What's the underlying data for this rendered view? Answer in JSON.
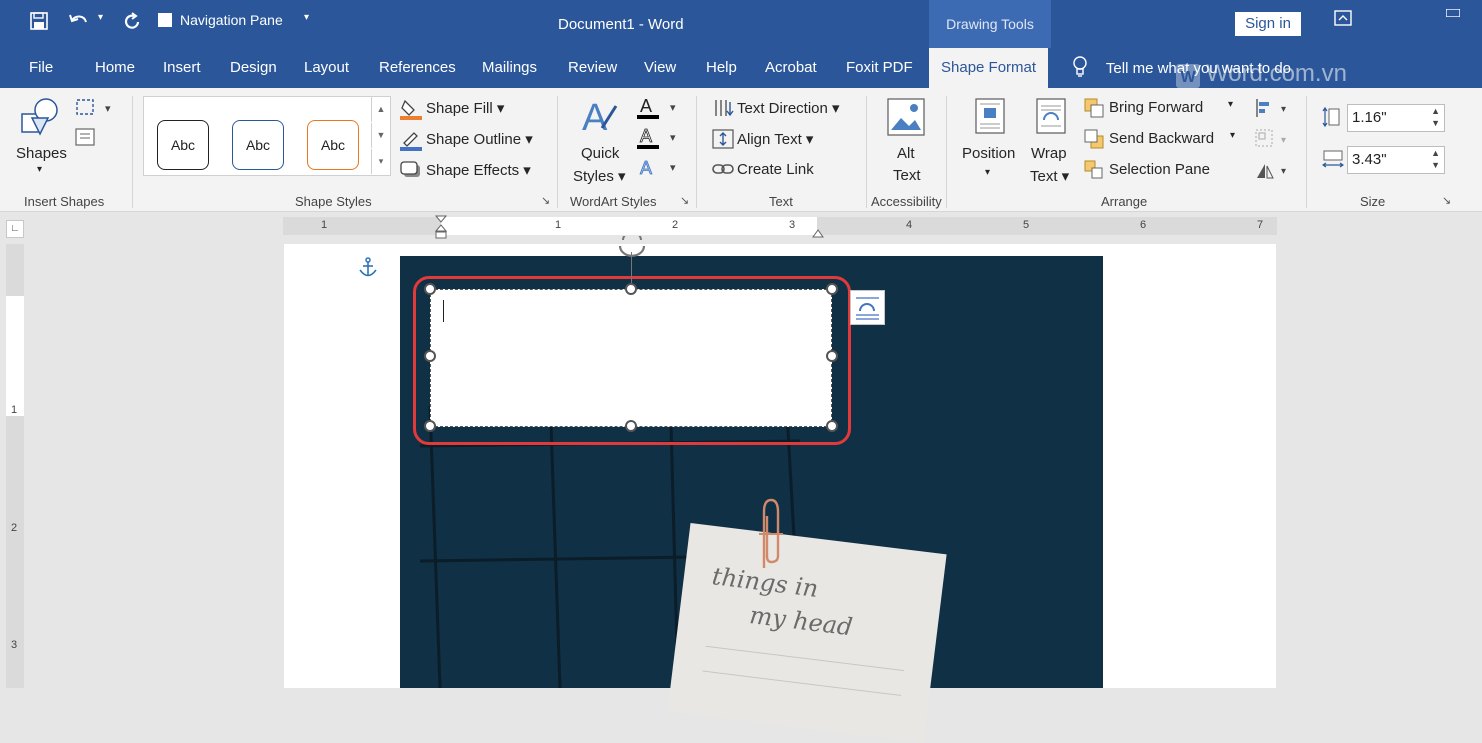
{
  "titlebar": {
    "navigation_pane_label": "Navigation Pane",
    "document_title": "Document1  -  Word",
    "contextual_header": "Drawing Tools",
    "sign_in_label": "Sign in"
  },
  "tabs": {
    "file": "File",
    "home": "Home",
    "insert": "Insert",
    "design": "Design",
    "layout": "Layout",
    "references": "References",
    "mailings": "Mailings",
    "review": "Review",
    "view": "View",
    "help": "Help",
    "acrobat": "Acrobat",
    "foxit": "Foxit PDF",
    "shape_format": "Shape Format",
    "tell_me": "Tell me what you want to do"
  },
  "ribbon": {
    "insert_shapes": {
      "shapes_label": "Shapes",
      "group_label": "Insert Shapes"
    },
    "shape_styles": {
      "style_labels": [
        "Abc",
        "Abc",
        "Abc"
      ],
      "shape_fill": "Shape Fill",
      "shape_outline": "Shape Outline",
      "shape_effects": "Shape Effects",
      "group_label": "Shape Styles"
    },
    "wordart_styles": {
      "quick_label": "Quick",
      "styles_label": "Styles",
      "group_label": "WordArt Styles"
    },
    "text": {
      "text_direction": "Text Direction",
      "align_text": "Align Text",
      "create_link": "Create Link",
      "group_label": "Text"
    },
    "accessibility": {
      "alt_label": "Alt",
      "text_label": "Text",
      "group_label": "Accessibility"
    },
    "arrange": {
      "position_label": "Position",
      "wrap_label": "Wrap",
      "wrap_text_label": "Text",
      "bring_forward": "Bring Forward",
      "send_backward": "Send Backward",
      "selection_pane": "Selection Pane",
      "group_label": "Arrange"
    },
    "size": {
      "height_value": "1.16\"",
      "width_value": "3.43\"",
      "group_label": "Size"
    }
  },
  "ruler": {
    "numbers": [
      "1",
      "1",
      "2",
      "3",
      "4",
      "5",
      "6",
      "7"
    ],
    "vertical_numbers": [
      "1",
      "2",
      "3"
    ]
  },
  "watermark": "Word.com.vn",
  "note": {
    "line1": "things  in",
    "line2": "my  head"
  },
  "colors": {
    "word_blue": "#2b579a",
    "highlight_red": "#e03a3a",
    "photo_background": "#123349"
  }
}
